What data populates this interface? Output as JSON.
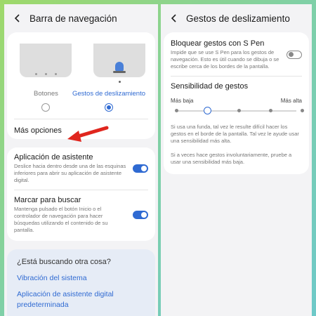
{
  "left": {
    "title": "Barra de navegación",
    "options": [
      {
        "label": "Botones",
        "selected": false
      },
      {
        "label": "Gestos de deslizamiento",
        "selected": true
      }
    ],
    "more_options": "Más opciones",
    "assistant": {
      "title": "Aplicación de asistente",
      "desc": "Deslice hacia dentro desde una de las esquinas inferiores para abrir su aplicación de asistente digital.",
      "enabled": true
    },
    "search": {
      "title": "Marcar para buscar",
      "desc": "Mantenga pulsado el botón Inicio o el controlador de navegación para hacer búsquedas utilizando el contenido de su pantalla.",
      "enabled": true
    },
    "looking": {
      "title": "¿Está buscando otra cosa?",
      "links": [
        "Vibración del sistema",
        "Aplicación de asistente digital predeterminada"
      ]
    }
  },
  "right": {
    "title": "Gestos de deslizamiento",
    "spen": {
      "title": "Bloquear gestos con S Pen",
      "desc": "Impide que se use S Pen para los gestos de navegación. Esto es útil cuando se dibuja o se escribe cerca de los bordes de la pantalla.",
      "enabled": false
    },
    "sensitivity": {
      "title": "Sensibilidad de gestos",
      "min_label": "Más baja",
      "max_label": "Más alta",
      "level": 1,
      "steps": 5
    },
    "info1": "Si usa una funda, tal vez le resulte difícil hacer los gestos en el borde de la pantalla. Tal vez le ayude usar una sensibilidad más alta.",
    "info2": "Si a veces hace gestos involuntariamente, pruebe a usar una sensibilidad más baja."
  },
  "colors": {
    "accent": "#2f6ad2",
    "annotation_arrow": "#e0261e"
  }
}
